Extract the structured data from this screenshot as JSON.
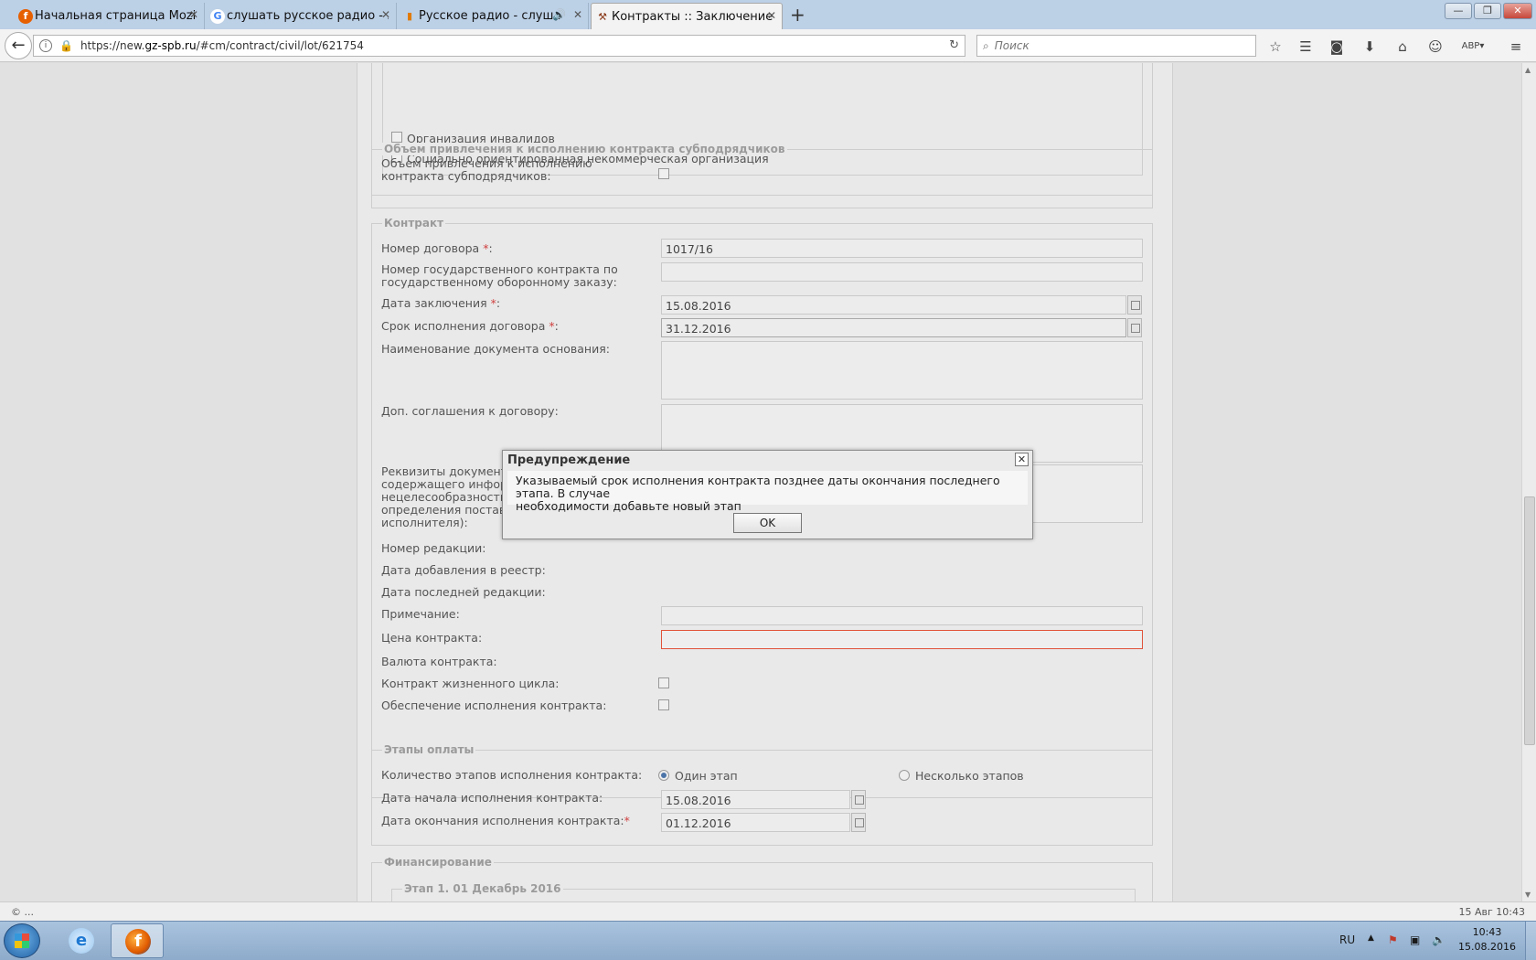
{
  "browser": {
    "tabs": [
      {
        "label": "Начальная страница Mozi...",
        "icon": "firefox-icon"
      },
      {
        "label": "слушать русское радио - ...",
        "icon": "google-icon"
      },
      {
        "label": "Русское радио - слуш...",
        "icon": "radio-bars-icon"
      },
      {
        "label": "Контракты :: Заключение ...",
        "icon": "gavel-icon"
      }
    ],
    "url_prefix": "https://new.",
    "url_domain": "gz-spb.ru",
    "url_suffix": "/#cm/contract/civil/lot/621754",
    "search_placeholder": "Поиск"
  },
  "form": {
    "org": {
      "disabled_org": "Организация инвалидов",
      "nko": "Социально ориентированная некоммерческая организация"
    },
    "subcontract": {
      "legend": "Объем привлечения к исполнению контракта субподрядчиков",
      "label": "Объем привлечения к исполнению контракта субподрядчиков:"
    },
    "contract": {
      "legend": "Контракт",
      "number_label": "Номер договора",
      "number_value": "1017/16",
      "gos_label": "Номер государственного контракта по государственному оборонному заказу:",
      "date_label": "Дата заключения",
      "date_value": "15.08.2016",
      "term_label": "Срок исполнения договора",
      "term_value": "31.12.2016",
      "doc_name_label": "Наименование документа основания:",
      "addendum_label": "Доп. соглашения к договору:",
      "requisites_l1": "Реквизиты документал",
      "requisites_l2": "содержащего информа",
      "requisites_l3": "нецелесообразности и",
      "requisites_l4": "определения поставщ",
      "requisites_l5": "исполнителя):",
      "revision_label": "Номер редакции:",
      "registry_date_label": "Дата добавления в реестр:",
      "last_edit_label": "Дата последней редакции:",
      "note_label": "Примечание:",
      "price_label": "Цена контракта:",
      "currency_label": "Валюта контракта:",
      "lifecycle_label": "Контракт жизненного цикла:",
      "guarantee_label": "Обеспечение исполнения контракта:"
    },
    "payment": {
      "legend": "Этапы оплаты",
      "stages_label": "Количество этапов исполнения контракта:",
      "one_stage": "Один этап",
      "many_stages": "Несколько этапов",
      "start_label": "Дата начала исполнения контракта:",
      "start_value": "15.08.2016",
      "end_label": "Дата окончания исполнения контракта:",
      "end_value": "01.12.2016"
    },
    "financing": {
      "legend": "Финансирование",
      "stage_legend": "Этап 1. 01 Декабрь 2016"
    }
  },
  "dialog": {
    "title": "Предупреждение",
    "message_l1": "Указываемый срок исполнения контракта позднее даты окончания последнего этапа. В случае",
    "message_l2": "необходимости добавьте новый этап",
    "ok": "OK"
  },
  "statusbar": {
    "left": "© ...",
    "right": "15 Авг 10:43"
  },
  "taskbar": {
    "lang": "RU",
    "time": "10:43",
    "date": "15.08.2016"
  },
  "colors": {
    "error_border": "#e0533a",
    "required": "#d04040",
    "radio_selected": "#4c74a8"
  }
}
